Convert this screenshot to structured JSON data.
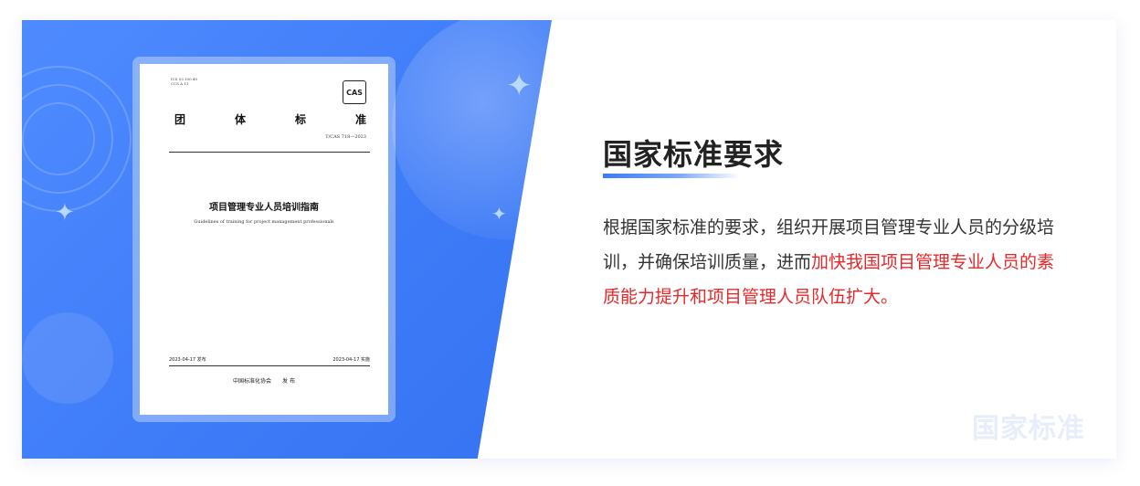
{
  "document": {
    "ics_line1": "ICS 03.100.40",
    "ics_line2": "CCS A 11",
    "logo_text": "CAS",
    "std_type_chars": [
      "团",
      "体",
      "标",
      "准"
    ],
    "std_code": "T/CAS 718—2023",
    "title_cn": "项目管理专业人员培训指南",
    "title_en": "Guidelines of training for project management professionals",
    "issue_date": "2023-04-17 发布",
    "effective_date": "2023-04-17 实施",
    "publisher": "中国标准化协会　　发 布"
  },
  "content": {
    "heading": "国家标准要求",
    "body_prefix": "根据国家标准的要求，组织开展项目管理专业人员的分级培训，并确保培训质量，进而",
    "body_highlight": "加快我国项目管理专业人员的素质能力提升和项目管理人员队伍扩大。",
    "watermark": "国家标准"
  },
  "colors": {
    "accent_blue": "#3f7cf8",
    "highlight_red": "#e8282a",
    "heading_text": "#222222"
  },
  "icons": [
    "sparkle-star-icon",
    "concentric-rings-decoration",
    "cas-logo"
  ]
}
